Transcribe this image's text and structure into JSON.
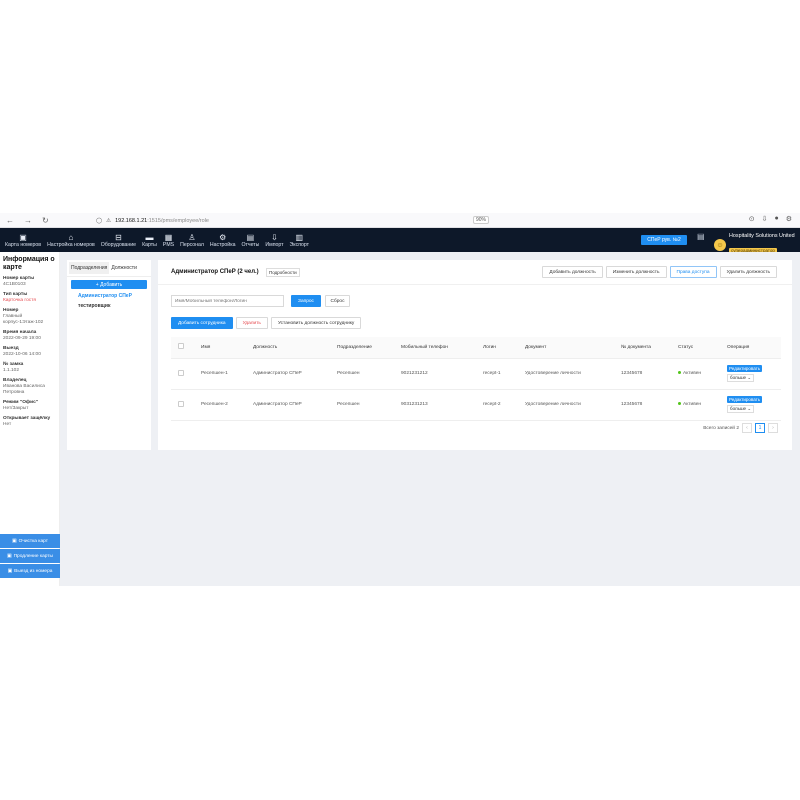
{
  "browser": {
    "url_host": "192.168.1.21",
    "url_path": ":1515/pms/employee/role",
    "zoom": "90%"
  },
  "topnav": {
    "items": [
      {
        "icon": "room-card-icon",
        "glyph": "▣",
        "label": "Карта номеров"
      },
      {
        "icon": "room-settings-icon",
        "glyph": "⌂",
        "label": "Настройка номеров"
      },
      {
        "icon": "equipment-icon",
        "glyph": "⊟",
        "label": "Оборудование"
      },
      {
        "icon": "cards-icon",
        "glyph": "▬",
        "label": "Карты"
      },
      {
        "icon": "pms-icon",
        "glyph": "▦",
        "label": "PMS"
      },
      {
        "icon": "staff-icon",
        "glyph": "♙",
        "label": "Персонал"
      },
      {
        "icon": "settings-icon",
        "glyph": "⚙",
        "label": "Настройка"
      },
      {
        "icon": "reports-icon",
        "glyph": "▤",
        "label": "Отчеты"
      },
      {
        "icon": "import-icon",
        "glyph": "⇩",
        "label": "Импорт"
      },
      {
        "icon": "export-icon",
        "glyph": "▥",
        "label": "Экспорт"
      }
    ],
    "room_button": "СПеР рув. №2",
    "org_name": "Hospitality Solutions United",
    "org_role": "суперадминистратор"
  },
  "left_panel": {
    "title": "Информация о карте",
    "fields": [
      {
        "label": "Номер карты",
        "value": "4C1B0103",
        "red": false
      },
      {
        "label": "Тип карты",
        "value": "Карточка гостя",
        "red": true
      },
      {
        "label": "Номер",
        "value": "Главный корпус-1Этаж-102",
        "red": false
      },
      {
        "label": "Время начала",
        "value": "2022-09-29 19:00",
        "red": false
      },
      {
        "label": "Выезд",
        "value": "2022-10-06 14:00",
        "red": false
      },
      {
        "label": "№ замка",
        "value": "1.1.102",
        "red": false
      },
      {
        "label": "Владелец",
        "value": "Иванова Василиса Петровна",
        "red": false
      },
      {
        "label": "Режим \"Офис\"",
        "value": "Нет/Закрыт",
        "red": false
      },
      {
        "label": "Открывает защёлку",
        "value": "Нет",
        "red": false
      }
    ],
    "actions": [
      "Очистка карт",
      "Продление карты",
      "Выезд из номера"
    ]
  },
  "tree": {
    "tabs": [
      "Подразделения",
      "Должности"
    ],
    "add_label": "+ Добавить",
    "items": [
      "Администратор СПеР",
      "тестировщик"
    ]
  },
  "main": {
    "title": "Администратор СПеР  (2 чел.)",
    "details": "Подробности",
    "header_actions": [
      "Добавить должность",
      "Изменить должность",
      "Права доступа",
      "Удалить должность"
    ],
    "search_placeholder": "Имя/Мобильный телефон/Логин",
    "query": "Запрос",
    "reset": "Сброс",
    "add_employee": "Добавить сотрудника",
    "delete": "Удалить",
    "set_position": "Установить должность сотруднику",
    "columns": [
      "Имя",
      "Должность",
      "Подразделение",
      "Мобильный телефон",
      "Логин",
      "Документ",
      "№ документа",
      "Статус",
      "Операция"
    ],
    "rows": [
      {
        "name": "Ресепшен-1",
        "position": "Администратор СПеР",
        "dept": "Ресепшен",
        "phone": "9021231212",
        "login": "recept-1",
        "doc": "Удостоверение личности",
        "doc_no": "12345678",
        "status": "Активен"
      },
      {
        "name": "Ресепшен-2",
        "position": "Администратор СПеР",
        "dept": "Ресепшен",
        "phone": "9031231213",
        "login": "recept-2",
        "doc": "Удостоверение личности",
        "doc_no": "12345678",
        "status": "Активен"
      }
    ],
    "edit": "Редактировать",
    "more": "больше",
    "total": "Всего записей 2",
    "page": "1"
  },
  "colors": {
    "nav_bg": "#0d1829",
    "primary": "#1f8ef1",
    "danger": "#e5484d",
    "active": "#52c41a"
  }
}
